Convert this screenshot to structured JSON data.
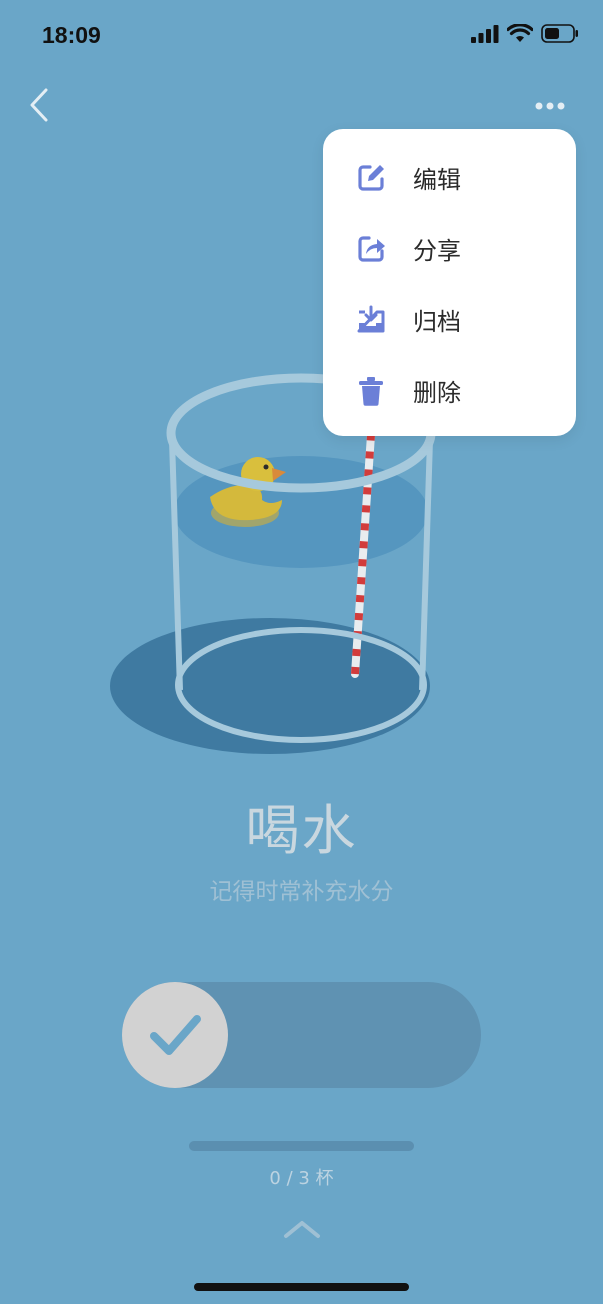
{
  "status_bar": {
    "time": "18:09"
  },
  "page": {
    "title": "喝水",
    "subtitle": "记得时常补充水分",
    "progress": {
      "done": 0,
      "total": 3,
      "label": "0 / 3 杯"
    }
  },
  "menu": {
    "items": [
      {
        "label": "编辑",
        "icon": "edit-icon"
      },
      {
        "label": "分享",
        "icon": "share-icon"
      },
      {
        "label": "归档",
        "icon": "archive-icon"
      },
      {
        "label": "删除",
        "icon": "trash-icon"
      }
    ]
  },
  "colors": {
    "background": "#6aa6c8",
    "menu_icon": "#6b7fd7",
    "swipe_track": "#5f92b2",
    "swipe_knob": "#d2d2d2",
    "check": "#6aa6c8"
  }
}
